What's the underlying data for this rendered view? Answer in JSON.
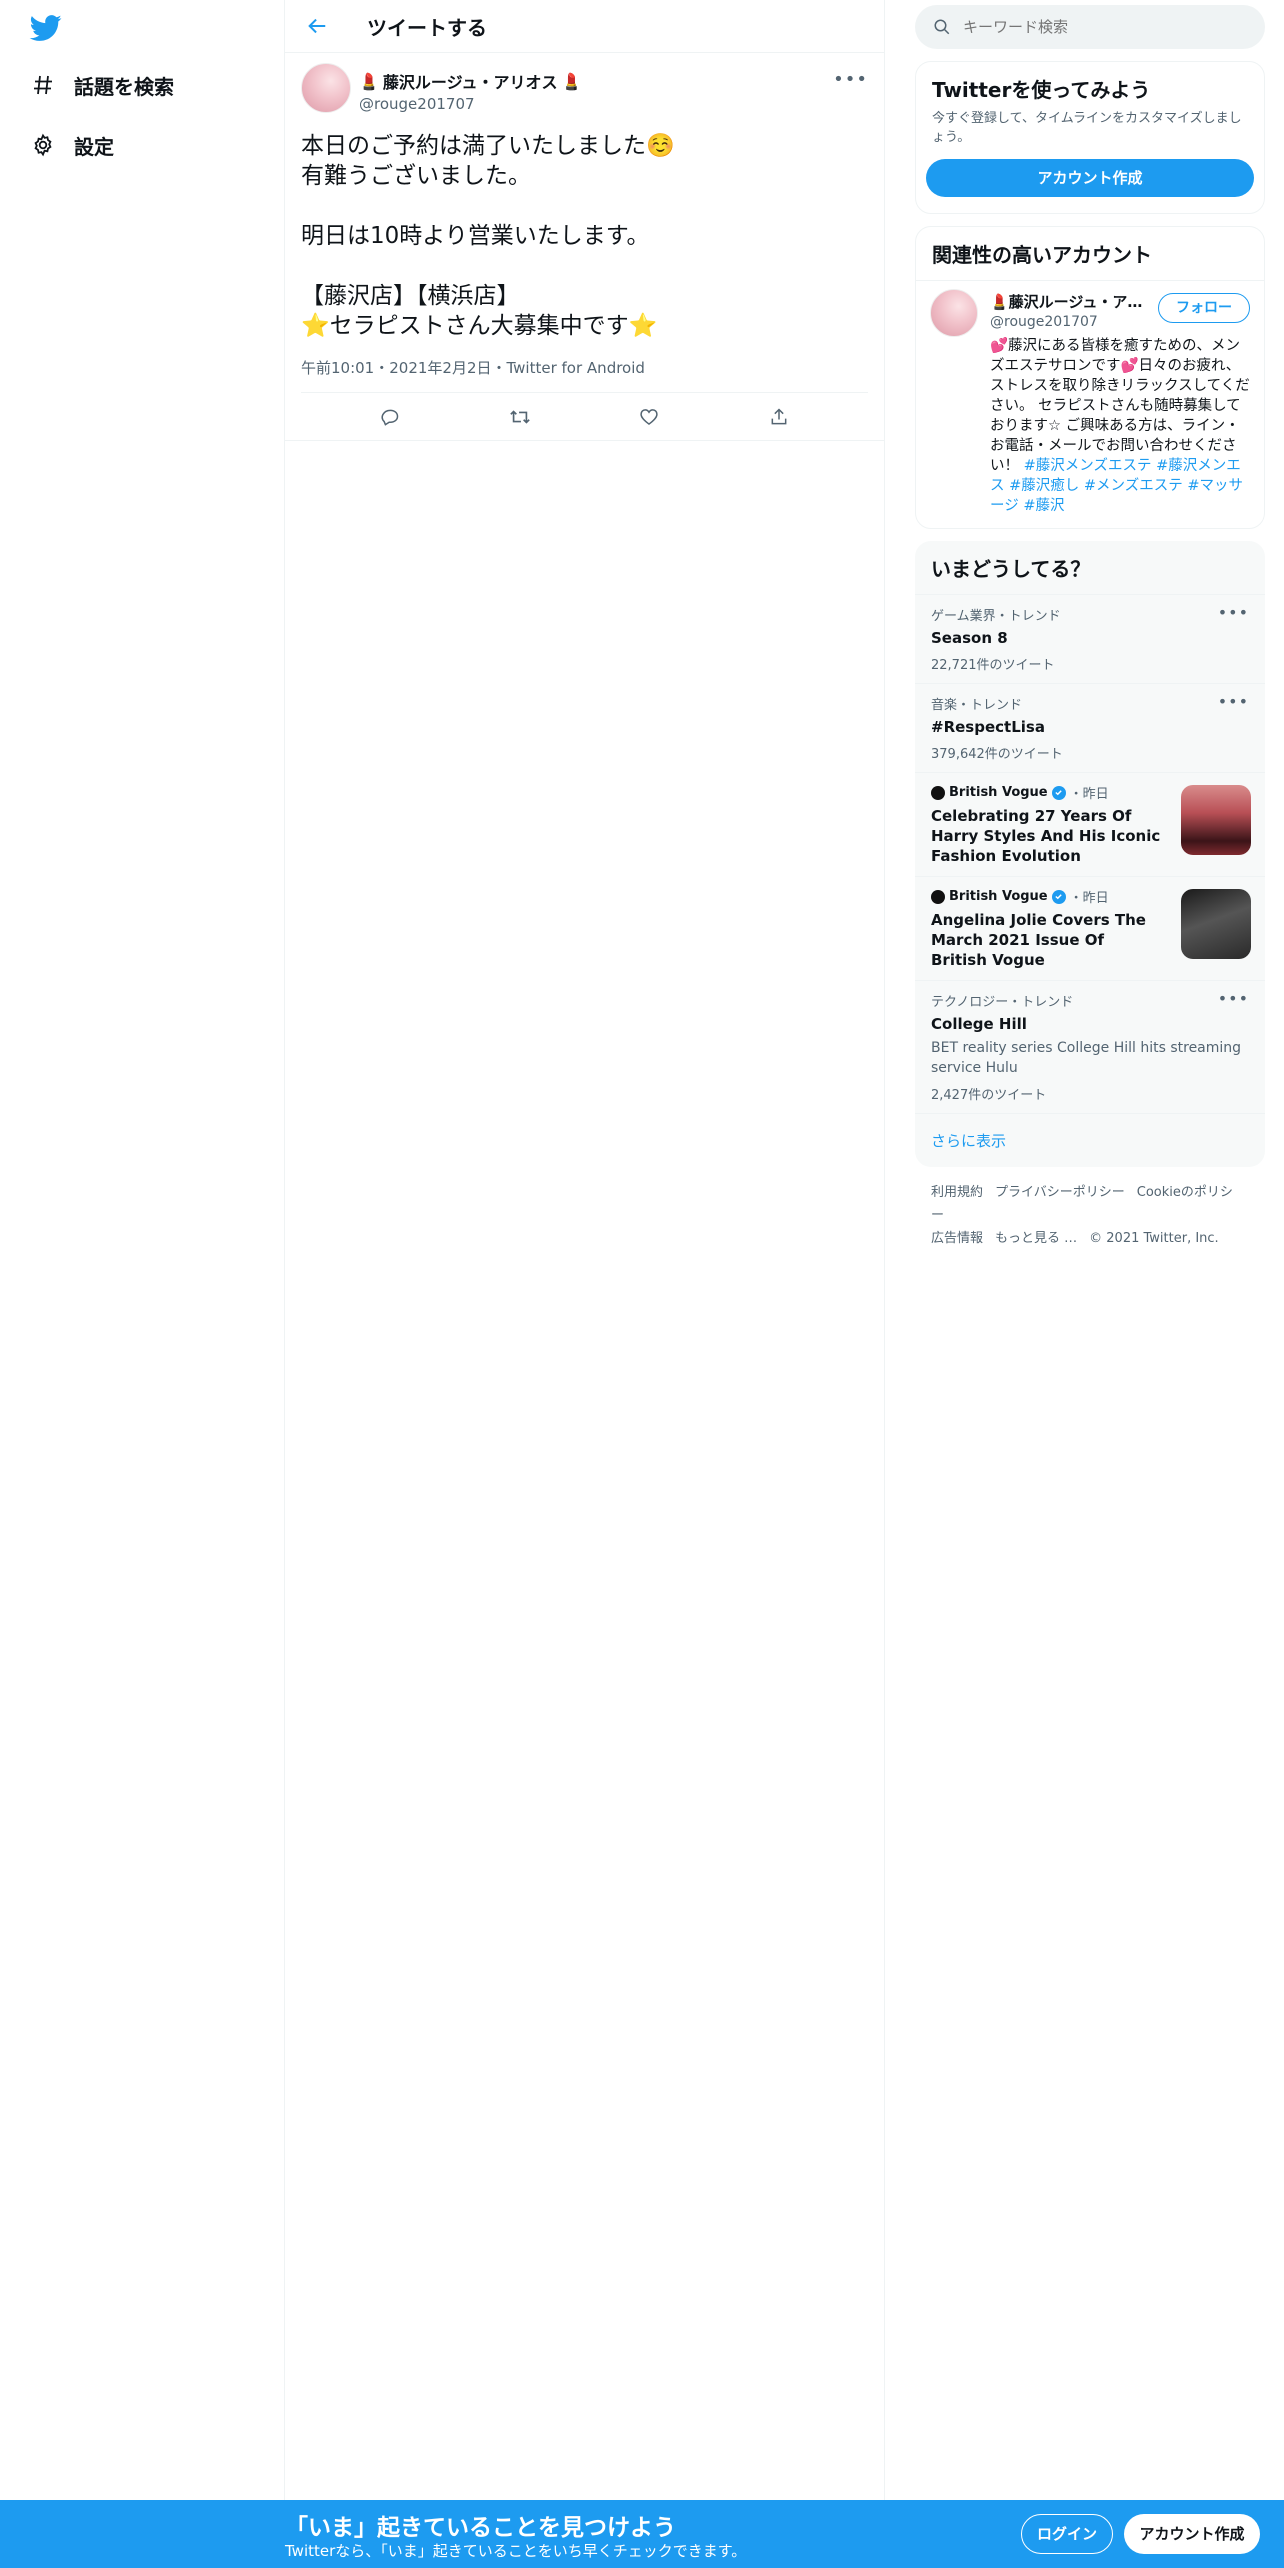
{
  "nav": {
    "logo_icon": "twitter-bird-icon",
    "items": [
      {
        "label": "話題を検索",
        "icon": "hashtag-icon"
      },
      {
        "label": "設定",
        "icon": "gear-icon"
      }
    ]
  },
  "header": {
    "title": "ツイートする",
    "back_icon": "arrow-left-icon"
  },
  "tweet": {
    "name": "藤沢ルージュ・アリオス",
    "name_emoji": "💄",
    "handle": "@rouge201707",
    "body": "本日のご予約は満了いたしました☺️\n有難うございました。\n\n明日は10時より営業いたします。\n\n【藤沢店】【横浜店】\n⭐セラピストさん大募集中です⭐",
    "meta": "午前10:01・2021年2月2日・Twitter for Android",
    "actions": [
      "reply-icon",
      "retweet-icon",
      "like-icon",
      "share-icon"
    ]
  },
  "search": {
    "placeholder": "キーワード検索"
  },
  "signup_card": {
    "title": "Twitterを使ってみよう",
    "desc": "今すぐ登録して、タイムラインをカスタマイズしましょう。",
    "button": "アカウント作成"
  },
  "relevant": {
    "title": "関連性の高いアカウント",
    "account": {
      "name": "💄藤沢ルージュ・アリオス💄",
      "handle": "@rouge201707",
      "follow": "フォロー",
      "bio": "💕藤沢にある皆様を癒すための、メンズエステサロンです💕日々のお疲れ、ストレスを取り除きリラックスしてください。 セラピストさんも随時募集しております☆ ご興味ある方は、ライン・お電話・メールでお問い合わせください！",
      "hashtags": "#藤沢メンズエステ #藤沢メンエス #藤沢癒し #メンズエステ #マッサージ #藤沢"
    }
  },
  "trends": {
    "title": "いまどうしてる？",
    "items": [
      {
        "category": "ゲーム業界・トレンド",
        "title": "Season 8",
        "count": "22,721件のツイート"
      },
      {
        "category": "音楽・トレンド",
        "title": "#RespectLisa",
        "count": "379,642件のツイート"
      },
      {
        "source": "British Vogue",
        "time": "・昨日",
        "title": "Celebrating 27 Years Of Harry Styles And His Iconic Fashion Evolution"
      },
      {
        "source": "British Vogue",
        "time": "・昨日",
        "title": "Angelina Jolie Covers The March 2021 Issue Of British Vogue"
      },
      {
        "category": "テクノロジー・トレンド",
        "title": "College Hill",
        "sub": "BET reality series College Hill hits streaming service Hulu",
        "count": "2,427件のツイート"
      }
    ],
    "show_more": "さらに表示"
  },
  "footer": {
    "links": [
      "利用規約",
      "プライバシーポリシー",
      "Cookieのポリシー",
      "広告情報",
      "もっと見る …"
    ],
    "copyright": "© 2021 Twitter, Inc."
  },
  "bottombar": {
    "title": "「いま」起きていることを見つけよう",
    "sub": "Twitterなら、「いま」起きていることをいち早くチェックできます。",
    "login": "ログイン",
    "signup": "アカウント作成"
  },
  "colors": {
    "accent": "#1d9bf0",
    "text": "#0f1419",
    "muted": "#536471",
    "border": "#eff3f4"
  }
}
